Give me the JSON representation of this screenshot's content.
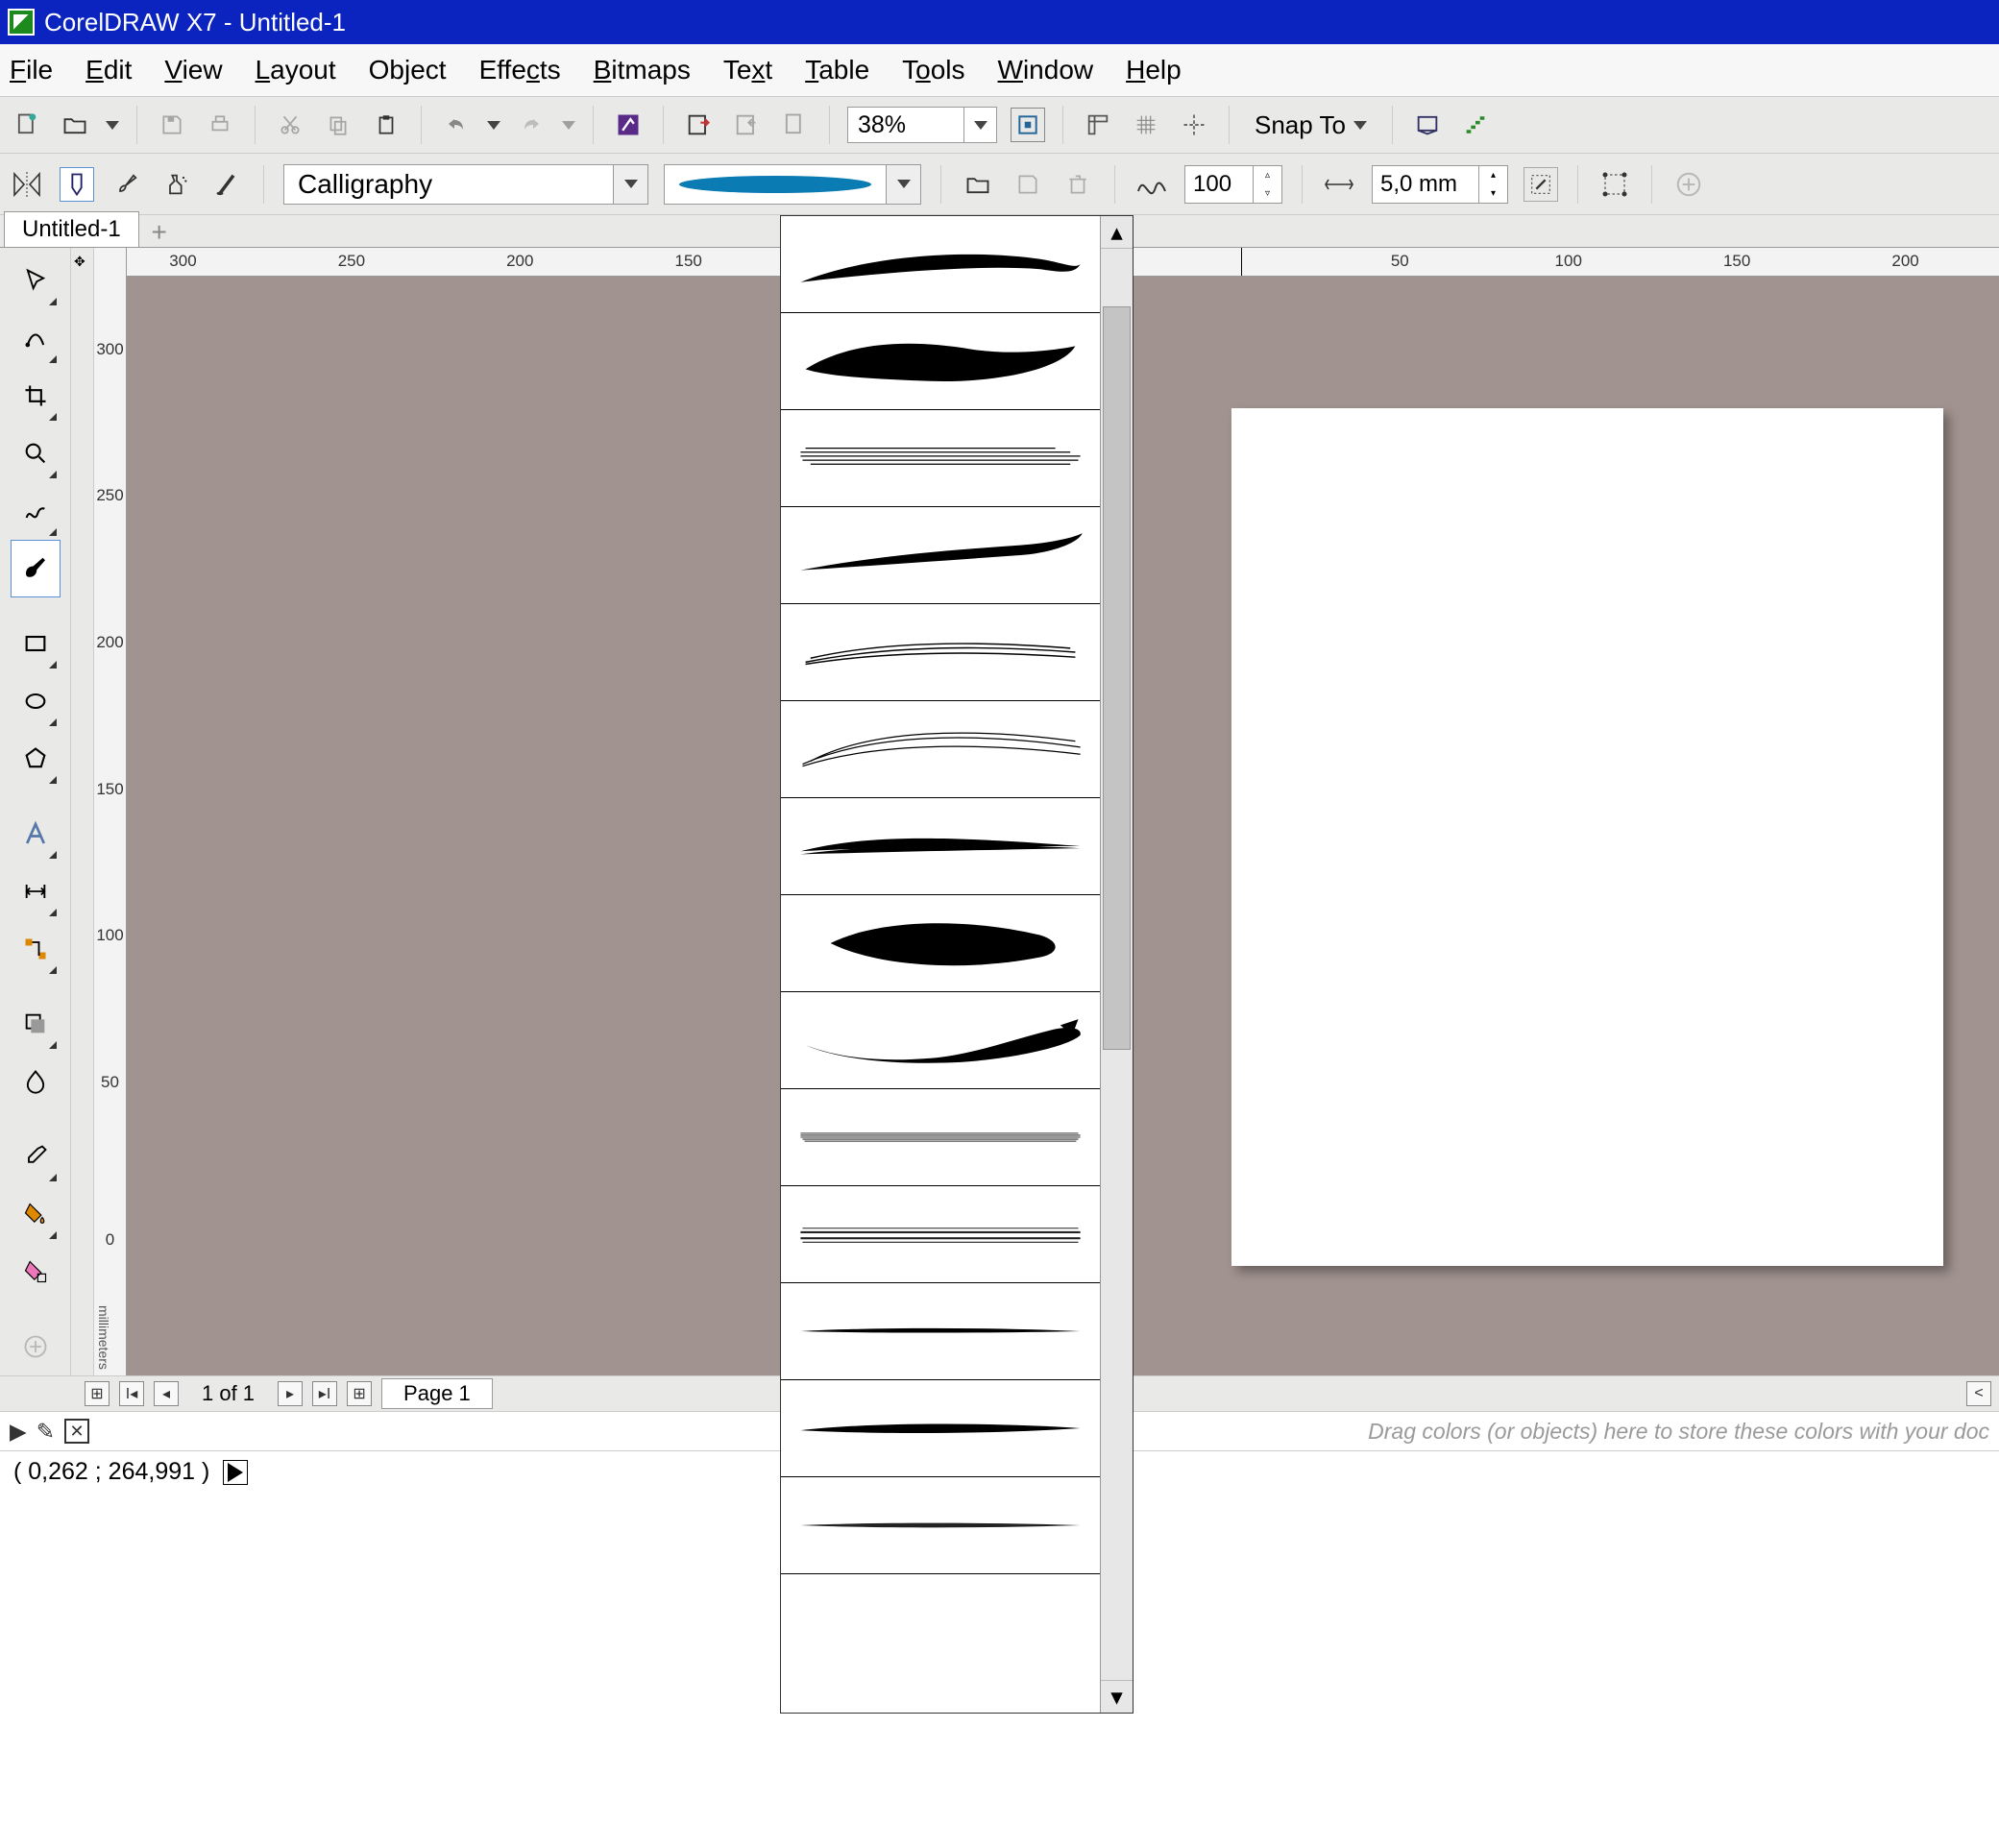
{
  "app": {
    "title": "CorelDRAW X7 - Untitled-1"
  },
  "menu": {
    "file": "File",
    "edit": "Edit",
    "view": "View",
    "layout": "Layout",
    "object": "Object",
    "effects": "Effects",
    "bitmaps": "Bitmaps",
    "text": "Text",
    "table": "Table",
    "tools": "Tools",
    "window": "Window",
    "help": "Help"
  },
  "toolbar": {
    "zoom": "38%",
    "snap": "Snap To"
  },
  "propbar": {
    "category": "Calligraphy",
    "smoothing": "100",
    "width": "5,0 mm"
  },
  "doc": {
    "tab": "Untitled-1"
  },
  "ruler": {
    "h": [
      "300",
      "250",
      "200",
      "150",
      "50",
      "100",
      "150",
      "200"
    ],
    "v": [
      "300",
      "250",
      "200",
      "150",
      "100",
      "50",
      "0"
    ],
    "unit": "millimeters"
  },
  "pagenav": {
    "counter": "1 of 1",
    "tab": "Page 1"
  },
  "hint": "Drag colors (or objects) here to store these colors with your doc",
  "status": {
    "coords": "( 0,262 ; 264,991 )"
  },
  "scroll_left_marker": "<"
}
